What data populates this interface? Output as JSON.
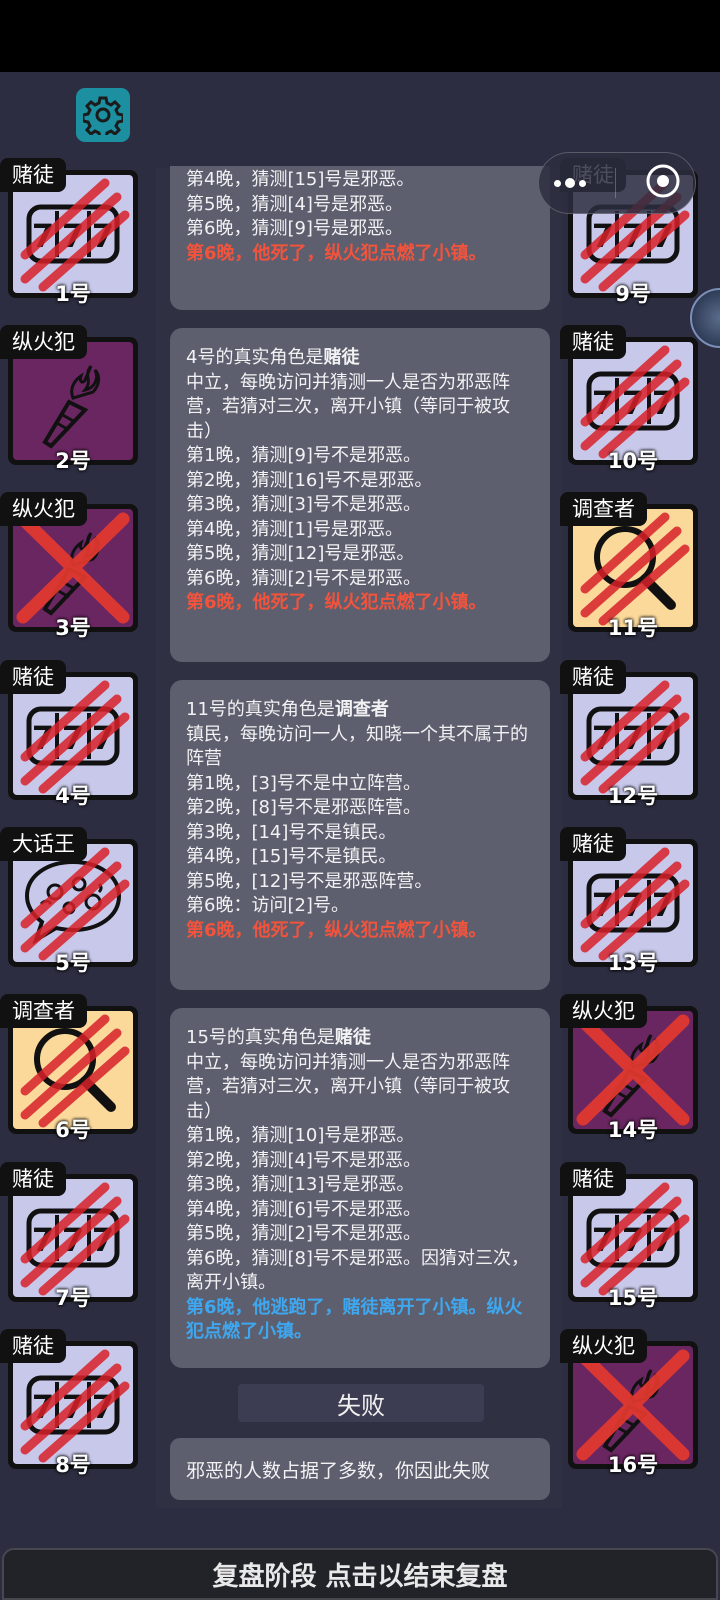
{
  "colors": {
    "background": "#2c2d40",
    "card": "#5d5f6e",
    "death_text": "#f2533c",
    "escape_text": "#3ea7ef",
    "gambler_bg": "#c8c8ea",
    "arsonist_bg": "#6a2661",
    "investigator_bg": "#fbd99a",
    "gear_button": "#1c8fa0"
  },
  "toolbar": {
    "settings_icon": "gear-icon"
  },
  "capsule": {
    "more_icon": "more-dots-icon",
    "close_icon": "target-close-icon"
  },
  "left_players": [
    {
      "role": "赌徒",
      "num": "1号",
      "icon": "slot-777-icon",
      "dead": true
    },
    {
      "role": "纵火犯",
      "num": "2号",
      "icon": "torch-icon",
      "dead": false
    },
    {
      "role": "纵火犯",
      "num": "3号",
      "icon": "torch-icon",
      "dead": true
    },
    {
      "role": "赌徒",
      "num": "4号",
      "icon": "slot-777-icon",
      "dead": true
    },
    {
      "role": "大话王",
      "num": "5号",
      "icon": "speech-bubble-icon",
      "dead": true
    },
    {
      "role": "调查者",
      "num": "6号",
      "icon": "magnifier-icon",
      "dead": true
    },
    {
      "role": "赌徒",
      "num": "7号",
      "icon": "slot-777-icon",
      "dead": true
    },
    {
      "role": "赌徒",
      "num": "8号",
      "icon": "slot-777-icon",
      "dead": true
    }
  ],
  "right_players": [
    {
      "role": "赌徒",
      "num": "9号",
      "icon": "slot-777-icon",
      "dead": true
    },
    {
      "role": "赌徒",
      "num": "10号",
      "icon": "slot-777-icon",
      "dead": true
    },
    {
      "role": "调查者",
      "num": "11号",
      "icon": "magnifier-icon",
      "dead": true
    },
    {
      "role": "赌徒",
      "num": "12号",
      "icon": "slot-777-icon",
      "dead": true
    },
    {
      "role": "赌徒",
      "num": "13号",
      "icon": "slot-777-icon",
      "dead": true
    },
    {
      "role": "纵火犯",
      "num": "14号",
      "icon": "torch-icon",
      "dead": true
    },
    {
      "role": "赌徒",
      "num": "15号",
      "icon": "slot-777-icon",
      "dead": true
    },
    {
      "role": "纵火犯",
      "num": "16号",
      "icon": "torch-icon",
      "dead": true
    }
  ],
  "log": {
    "card1": {
      "lines": [
        "第4晚，猜测[15]号是邪恶。",
        "第5晚，猜测[4]号是邪恶。",
        "第6晚，猜测[9]号是邪恶。"
      ],
      "death": "第6晚，他死了，纵火犯点燃了小镇。"
    },
    "card2": {
      "title_prefix": "4号的真实角色是",
      "role": "赌徒",
      "desc": "中立，每晚访问并猜测一人是否为邪恶阵营，若猜对三次，离开小镇（等同于被攻击）",
      "lines": [
        "第1晚，猜测[9]号不是邪恶。",
        "第2晚，猜测[16]号不是邪恶。",
        "第3晚，猜测[3]号不是邪恶。",
        "第4晚，猜测[1]号是邪恶。",
        "第5晚，猜测[12]号是邪恶。",
        "第6晚，猜测[2]号不是邪恶。"
      ],
      "death": "第6晚，他死了，纵火犯点燃了小镇。"
    },
    "card3": {
      "title_prefix": "11号的真实角色是",
      "role": "调查者",
      "desc": "镇民，每晚访问一人，知晓一个其不属于的阵营",
      "lines": [
        "第1晚，[3]号不是中立阵营。",
        "第2晚，[8]号不是邪恶阵营。",
        "第3晚，[14]号不是镇民。",
        "第4晚，[15]号不是镇民。",
        "第5晚，[12]号不是邪恶阵营。",
        "第6晚：访问[2]号。"
      ],
      "death": "第6晚，他死了，纵火犯点燃了小镇。"
    },
    "card4": {
      "title_prefix": "15号的真实角色是",
      "role": "赌徒",
      "desc": "中立，每晚访问并猜测一人是否为邪恶阵营，若猜对三次，离开小镇（等同于被攻击）",
      "lines": [
        "第1晚，猜测[10]号是邪恶。",
        "第2晚，猜测[4]号不是邪恶。",
        "第3晚，猜测[13]号是邪恶。",
        "第4晚，猜测[6]号不是邪恶。",
        "第5晚，猜测[2]号不是邪恶。",
        "第6晚，猜测[8]号不是邪恶。因猜对三次，离开小镇。"
      ],
      "escape": "第6晚，他逃跑了，赌徒离开了小镇。纵火犯点燃了小镇。"
    }
  },
  "result": {
    "title": "失败",
    "message": "邪恶的人数占据了多数，你因此失败"
  },
  "footer": {
    "label": "复盘阶段 点击以结束复盘"
  }
}
